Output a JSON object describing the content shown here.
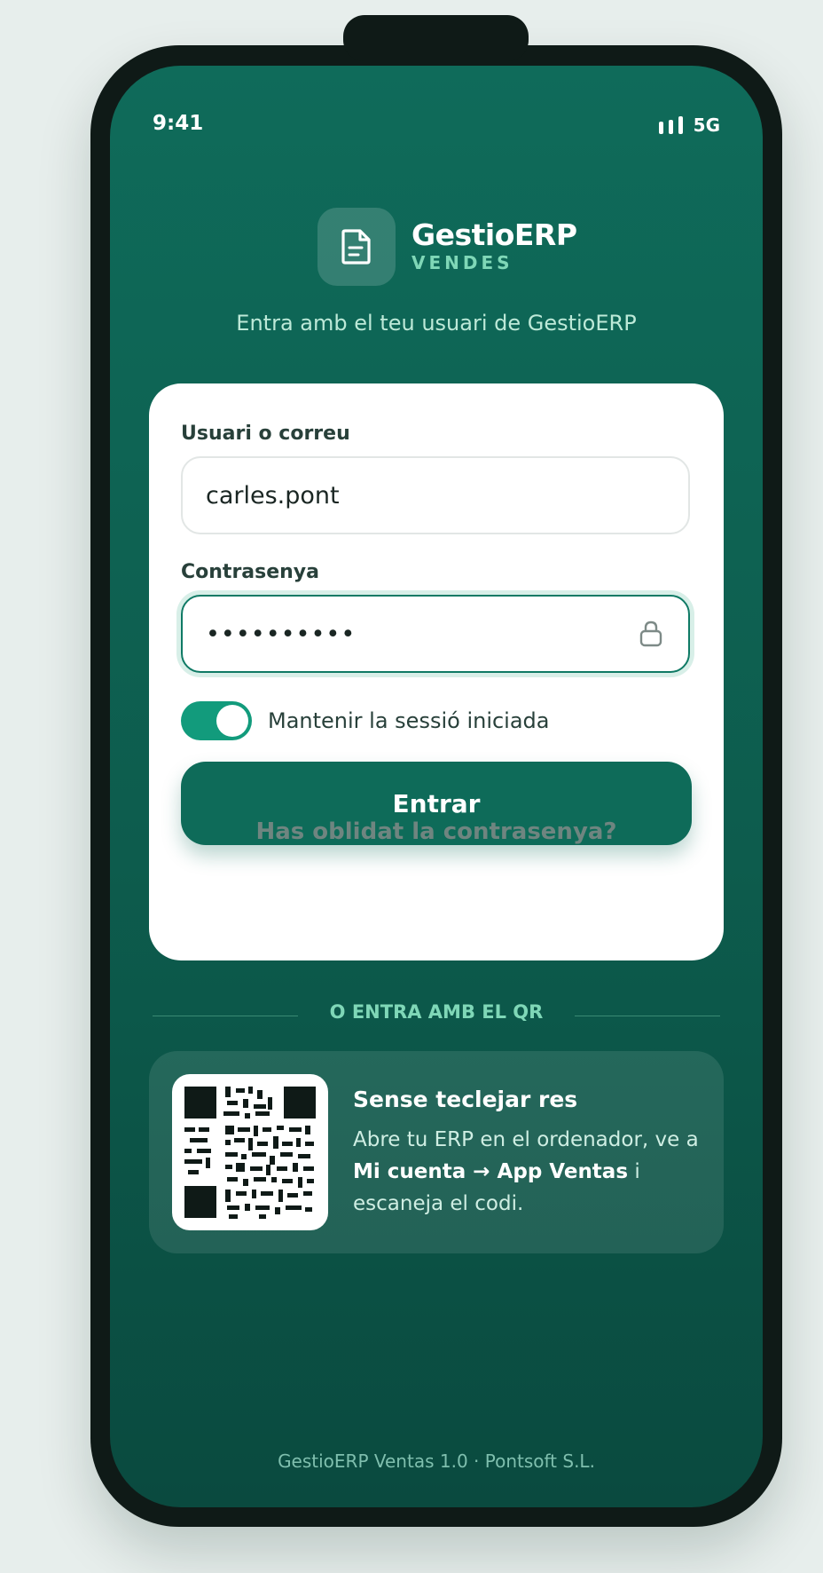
{
  "status_bar": {
    "time": "9:41",
    "network": "5G"
  },
  "brand": {
    "name": "GestioERP",
    "module": "VENDES",
    "icon": "document-icon"
  },
  "subtitle": "Entra amb el teu usuari de GestioERP",
  "form": {
    "username_label": "Usuari o correu",
    "username_value": "carles.pont",
    "password_label": "Contrasenya",
    "password_value": "••••••••••",
    "password_icon": "lock-icon",
    "keep_session_label": "Mantenir la sessió iniciada",
    "keep_session_on": true,
    "submit_label": "Entrar",
    "forgot_label": "Has oblidat la contrasenya?"
  },
  "divider_label": "O ENTRA AMB EL QR",
  "qr": {
    "title": "Sense teclejar res",
    "desc_prefix": "Abre tu ERP en el ordenador, ve a",
    "desc_path": "Mi cuenta → App Ventas",
    "desc_suffix": "escaneja el codi.",
    "desc_connector": "i"
  },
  "footer": "GestioERP Ventas 1.0 · Pontsoft S.L.",
  "colors": {
    "background": "#e7eeec",
    "screen_top": "#0f6b5a",
    "screen_bottom": "#0a4a3f",
    "accent": "#129b7c",
    "button": "#0e6b59",
    "mint": "#7fd7b7"
  }
}
